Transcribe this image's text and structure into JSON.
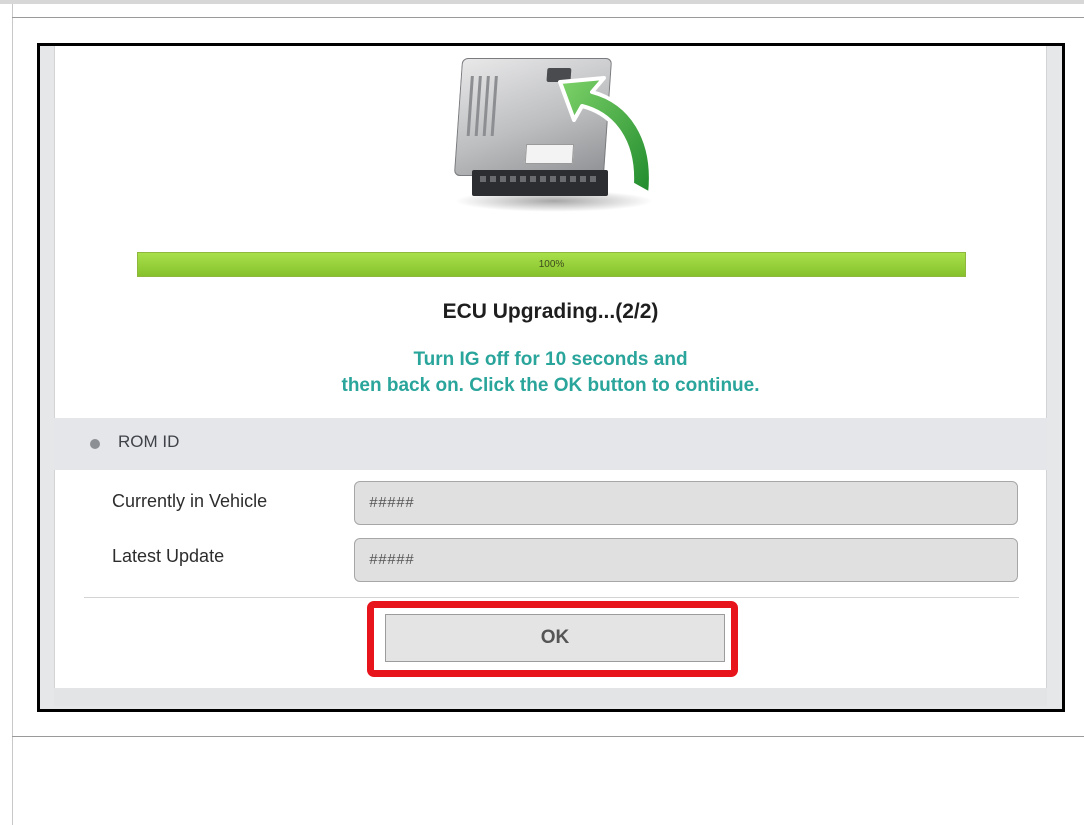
{
  "progress": {
    "percent_label": "100%",
    "fraction": 1.0
  },
  "status": {
    "title": "ECU Upgrading...(2/2)",
    "message_line1": "Turn IG off for 10 seconds and",
    "message_line2": "then back on. Click the OK button to continue."
  },
  "rom_section": {
    "label": "ROM ID",
    "rows": [
      {
        "label": "Currently in Vehicle",
        "value": "#####"
      },
      {
        "label": "Latest Update",
        "value": "#####"
      }
    ]
  },
  "actions": {
    "ok_label": "OK"
  },
  "icons": {
    "illustration": "ecu-upgrade-icon",
    "section_bullet": "bullet-dot-icon"
  },
  "colors": {
    "progress_green": "#8fc93a",
    "message_teal": "#2aa59b",
    "highlight_red": "#e8141b"
  }
}
